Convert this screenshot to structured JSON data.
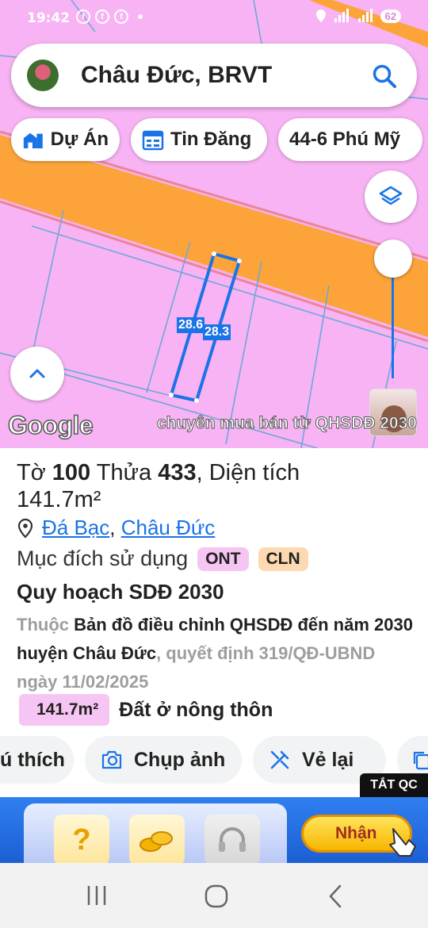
{
  "status_bar": {
    "time": "19:42",
    "battery": "62"
  },
  "search": {
    "location": "Châu Đức, BRVT"
  },
  "chips": {
    "projects": "Dự Án",
    "listings": "Tin Đăng",
    "place": "44-6 Phú Mỹ"
  },
  "map": {
    "dim_1": "28.6",
    "dim_2": "28.3",
    "google": "Google",
    "caption": "chuyên mua bán từ QHSDĐ 2030"
  },
  "parcel": {
    "sheet_label": "Tờ",
    "sheet_no": "100",
    "plot_label": "Thửa",
    "plot_no": "433",
    "area_label": "Diện tích",
    "area": "141.7m²",
    "ward": "Đá Bạc",
    "district": "Châu Đức",
    "purpose_label": "Mục đích sử dụng",
    "badge_1": "ONT",
    "badge_2": "CLN",
    "plan_title": "Quy hoạch SDĐ 2030",
    "plan_prefix": "Thuộc",
    "plan_map": "Bản đồ điều chỉnh QHSDĐ đến năm 2030 huyện Châu Đức",
    "plan_suffix": ", quyết định 319/QĐ-UBND ngày 11/02/2025",
    "zone_area": "141.7m²",
    "zone_type": "Đất ở nông thôn"
  },
  "actions": {
    "note": "ú thích",
    "photo": "Chụp ảnh",
    "redraw": "Vẻ lại"
  },
  "ad": {
    "close": "TẮT QC",
    "cta": "Nhận"
  },
  "colors": {
    "land": "#f7b3f3",
    "road": "#fca43a",
    "accent": "#1a73e8",
    "ont": "#f7c5f3",
    "cln": "#fcd9b0"
  }
}
